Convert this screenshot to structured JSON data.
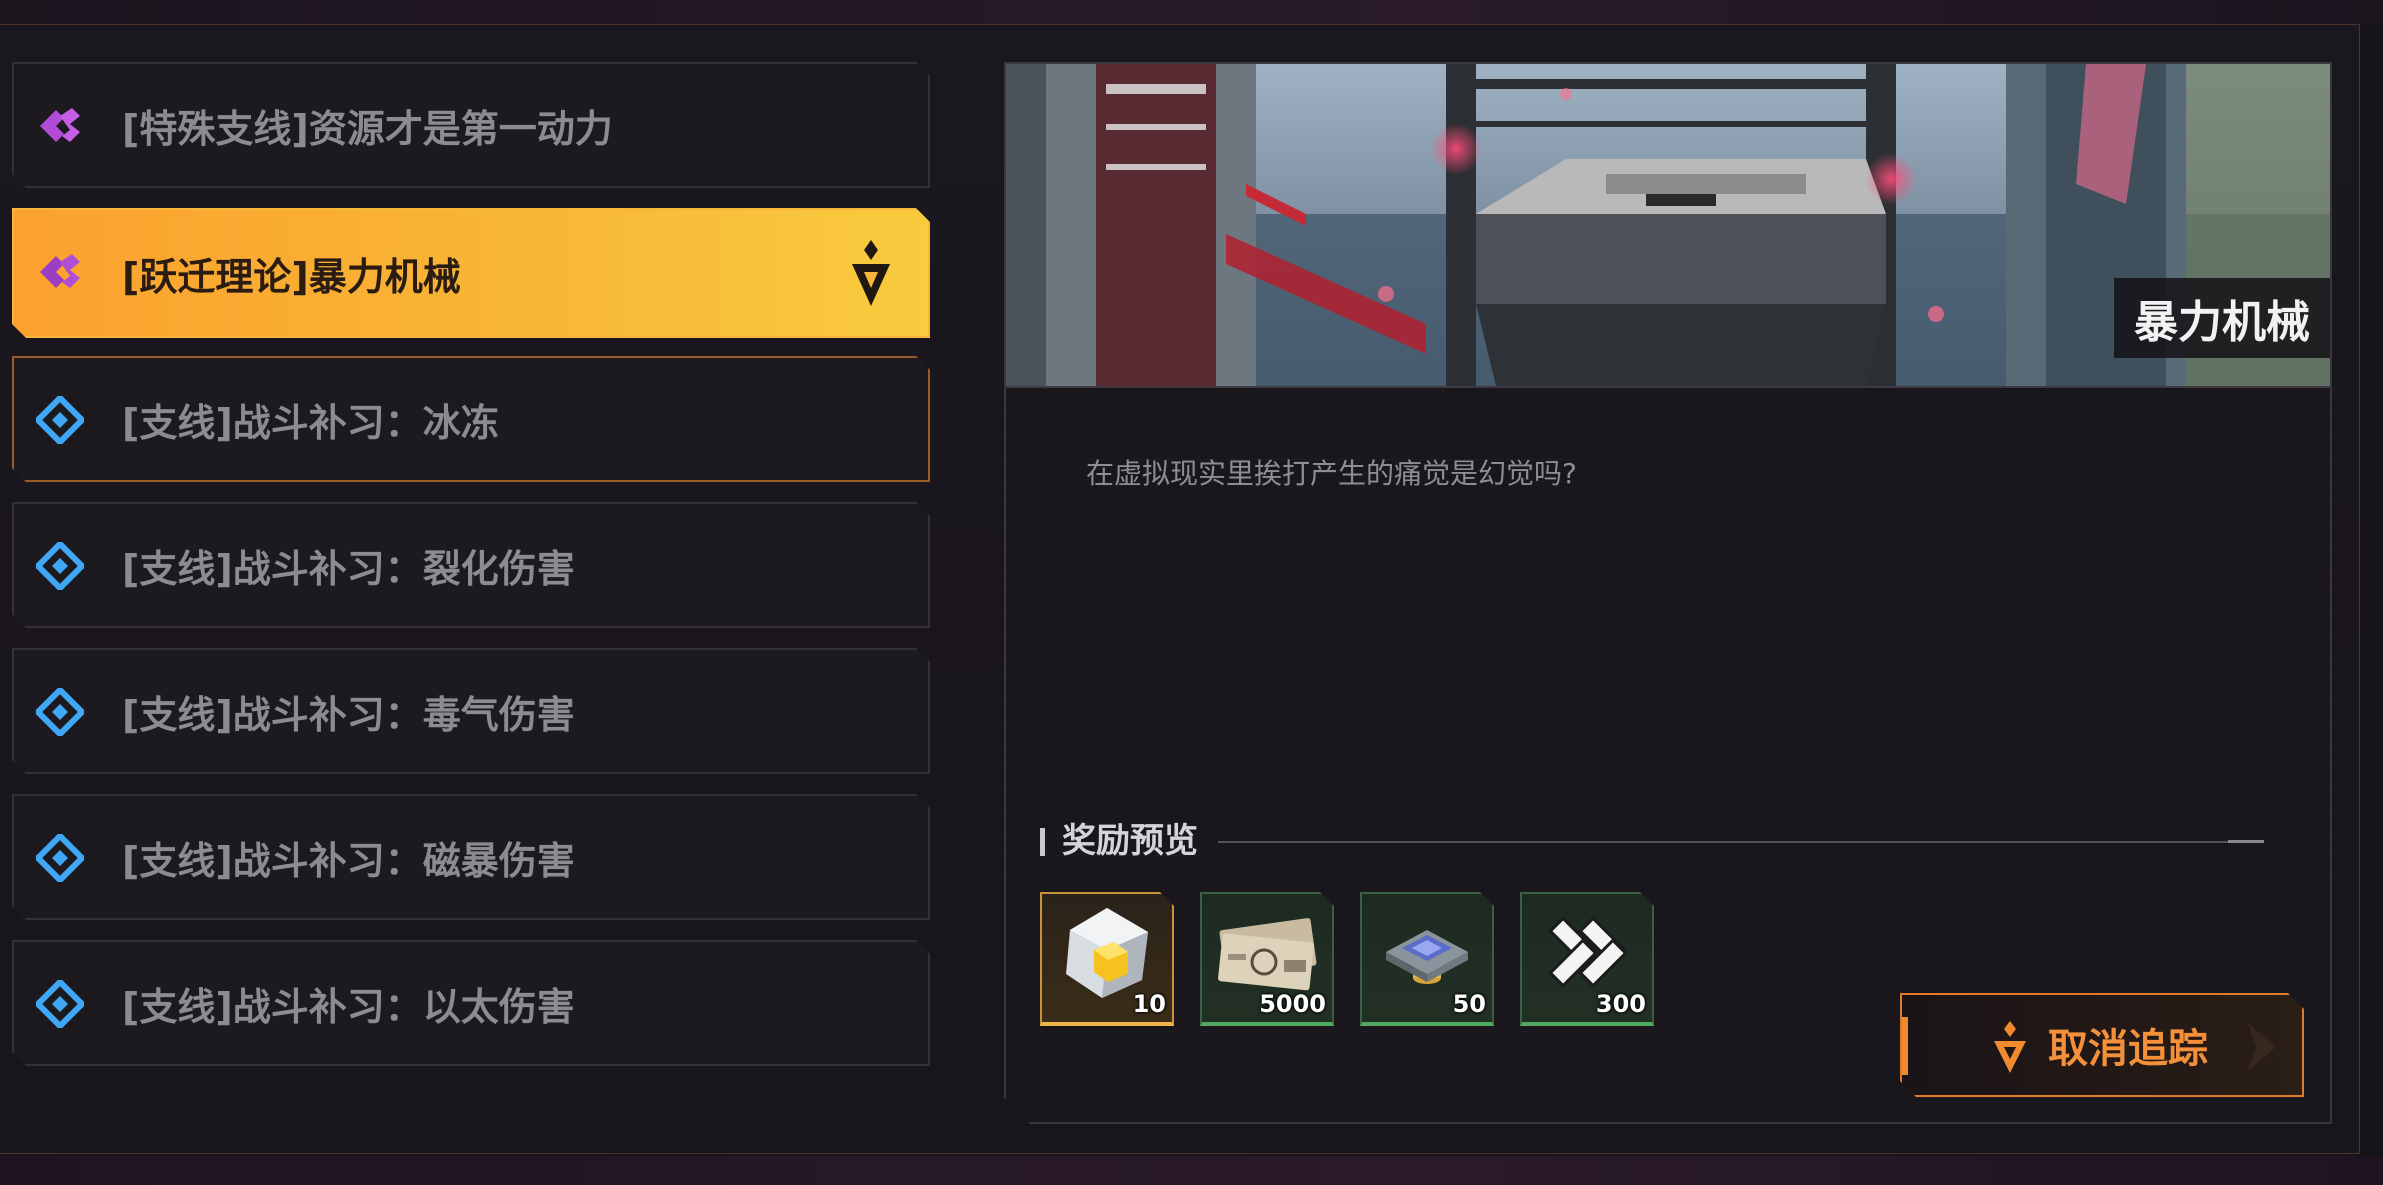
{
  "quests": [
    {
      "label": "[特殊支线]资源才是第一动力",
      "icon": "special-quest-icon",
      "state": "normal"
    },
    {
      "label": "[跃迁理论]暴力机械",
      "icon": "special-quest-icon",
      "state": "selected"
    },
    {
      "label": "[支线]战斗补习：冰冻",
      "icon": "side-quest-icon",
      "state": "tracked"
    },
    {
      "label": "[支线]战斗补习：裂化伤害",
      "icon": "side-quest-icon",
      "state": "normal"
    },
    {
      "label": "[支线]战斗补习：毒气伤害",
      "icon": "side-quest-icon",
      "state": "normal"
    },
    {
      "label": "[支线]战斗补习：磁暴伤害",
      "icon": "side-quest-icon",
      "state": "normal"
    },
    {
      "label": "[支线]战斗补习：以太伤害",
      "icon": "side-quest-icon",
      "state": "normal"
    }
  ],
  "detail": {
    "title": "暴力机械",
    "description": "在虚拟现实里挨打产生的痛觉是幻觉吗?",
    "reward_header": "奖励预览",
    "rewards": [
      {
        "icon": "crystal-cube-icon",
        "qty": "10",
        "rarity": "gold"
      },
      {
        "icon": "banknotes-icon",
        "qty": "5000",
        "rarity": "green"
      },
      {
        "icon": "chip-stack-icon",
        "qty": "50",
        "rarity": "green"
      },
      {
        "icon": "material-chain-icon",
        "qty": "300",
        "rarity": "green"
      }
    ],
    "cancel_label": "取消追踪"
  },
  "colors": {
    "selected": "#f8b636",
    "accent": "#f08a2e",
    "side_icon": "#3fa7f5",
    "special_icon": "#b34bd8"
  }
}
